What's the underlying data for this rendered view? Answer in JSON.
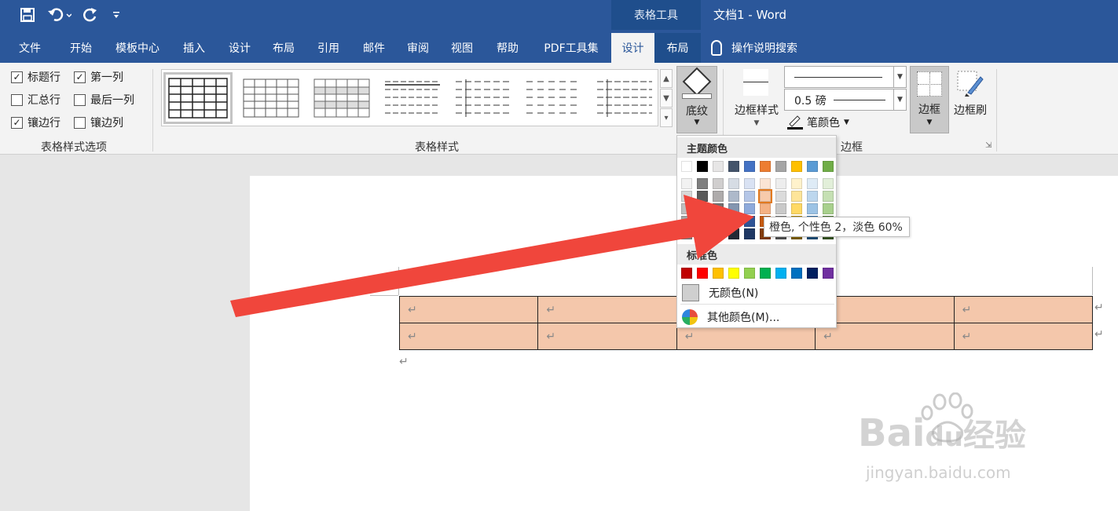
{
  "quick_access": {
    "save_icon": "save-icon",
    "undo_icon": "undo-icon",
    "redo_icon": "redo-icon",
    "customize_icon": "customize-qat-icon"
  },
  "context_group": "表格工具",
  "title": "文档1 - Word",
  "tabs": [
    "文件",
    "开始",
    "模板中心",
    "插入",
    "设计",
    "布局",
    "引用",
    "邮件",
    "审阅",
    "视图",
    "帮助",
    "PDF工具集",
    "设计",
    "布局"
  ],
  "active_tab_index": 12,
  "tell_me": "操作说明搜索",
  "ribbon": {
    "style_options": {
      "items": [
        {
          "label": "标题行",
          "checked": true
        },
        {
          "label": "第一列",
          "checked": true
        },
        {
          "label": "汇总行",
          "checked": false
        },
        {
          "label": "最后一列",
          "checked": false
        },
        {
          "label": "镶边行",
          "checked": true
        },
        {
          "label": "镶边列",
          "checked": false
        }
      ],
      "group_label": "表格样式选项"
    },
    "table_styles_label": "表格样式",
    "shading_label": "底纹",
    "border_styles_label": "边框样式",
    "line_weight": "0.5 磅",
    "pen_color_label": "笔颜色",
    "borders_label": "边框",
    "border_painter_label": "边框刷",
    "borders_group_label": "边框"
  },
  "color_menu": {
    "theme_colors_label": "主题颜色",
    "standard_colors_label": "标准色",
    "no_color": "无颜色(N)",
    "more_colors": "其他颜色(M)...",
    "theme_base": [
      "#ffffff",
      "#000000",
      "#e7e6e6",
      "#44546a",
      "#4472c4",
      "#ed7d31",
      "#a5a5a5",
      "#ffc000",
      "#5b9bd5",
      "#70ad47"
    ],
    "theme_tints": [
      [
        "#f2f2f2",
        "#7f7f7f",
        "#d0cece",
        "#d6dce4",
        "#d9e2f3",
        "#fbe5d5",
        "#ededed",
        "#fff2cc",
        "#deebf6",
        "#e2efd9"
      ],
      [
        "#d8d8d8",
        "#595959",
        "#aeabab",
        "#adb9ca",
        "#b4c6e7",
        "#f7cbac",
        "#dbdbdb",
        "#fee599",
        "#bdd7ee",
        "#c5e0b3"
      ],
      [
        "#bfbfbf",
        "#3f3f3f",
        "#757070",
        "#8496b0",
        "#8eaadb",
        "#f4b183",
        "#c9c9c9",
        "#ffd965",
        "#9cc3e5",
        "#a8d08d"
      ],
      [
        "#a5a5a5",
        "#262626",
        "#3a3838",
        "#323f4f",
        "#2f5496",
        "#c55a11",
        "#7b7b7b",
        "#bf9000",
        "#2e75b5",
        "#538135"
      ],
      [
        "#7f7f7f",
        "#0c0c0c",
        "#171616",
        "#222a35",
        "#1f3864",
        "#833c0b",
        "#525252",
        "#7f6000",
        "#1e4e79",
        "#375623"
      ]
    ],
    "standard": [
      "#c00000",
      "#ff0000",
      "#ffc000",
      "#ffff00",
      "#92d050",
      "#00b050",
      "#00b0f0",
      "#0070c0",
      "#002060",
      "#7030a0"
    ],
    "highlighted_color": "#f7cbac"
  },
  "tooltip": "橙色, 个性色 2，淡色 60%",
  "document": {
    "paragraph_mark": "↵",
    "table_rows": 2,
    "table_cols": 5,
    "cell_fill": "#f4c7ab"
  },
  "watermark": {
    "brand": "Bai",
    "brand_tail": "du",
    "suffix": "经验",
    "url": "jingyan.baidu.com"
  }
}
